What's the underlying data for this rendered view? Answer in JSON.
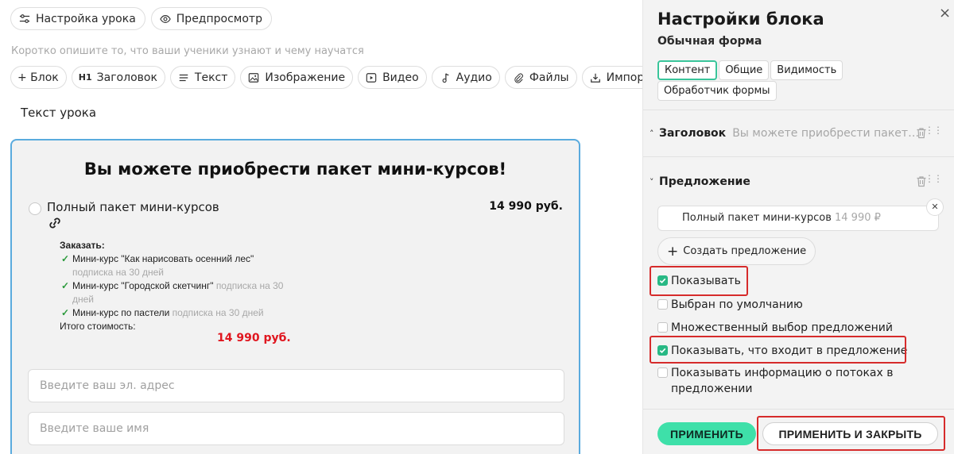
{
  "editor": {
    "lesson_settings_label": "Настройка урока",
    "preview_label": "Предпросмотр",
    "description_placeholder": "Коротко опишите то, что ваши ученики узнают и чему научатся",
    "toolbar": {
      "block": "+ Блок",
      "heading_tag": "H1",
      "heading": "Заголовок",
      "text": "Текст",
      "image": "Изображение",
      "video": "Видео",
      "audio": "Аудио",
      "files": "Файлы",
      "import": "Импорт"
    },
    "lesson_text_label": "Текст урока",
    "form": {
      "title": "Вы можете приобрести пакет мини-курсов!",
      "offer_name": "Полный пакет мини-курсов",
      "offer_price": "14 990 руб.",
      "order_label": "Заказать:",
      "items": [
        {
          "name": "Мини-курс \"Как нарисовать осенний лес\"",
          "sub": "подписка на 30 дней"
        },
        {
          "name": "Мини-курс \"Городской скетчинг\"",
          "sub": "подписка на 30 дней"
        },
        {
          "name": "Мини-курс по пастели",
          "sub": "подписка на 30 дней"
        }
      ],
      "total_label": "Итого стоимость:",
      "total_price": "14 990 руб.",
      "email_placeholder": "Введите ваш эл. адрес",
      "name_placeholder": "Введите ваше имя"
    }
  },
  "panel": {
    "title": "Настройки блока",
    "close": "×",
    "subtitle": "Обычная форма",
    "tabs": [
      "Контент",
      "Общие",
      "Видимость",
      "Обработчик формы"
    ],
    "active_tab": "Контент",
    "heading_section": {
      "label": "Заголовок",
      "value": "Вы можете приобрести пакет мини-курсов!"
    },
    "offer_section": {
      "label": "Предложение"
    },
    "offer_chip": {
      "name": "Полный пакет мини-курсов",
      "price": "14 990 ₽"
    },
    "create_offer": "Создать предложение",
    "checkboxes": [
      {
        "label": "Показывать",
        "checked": true
      },
      {
        "label": "Выбран по умолчанию",
        "checked": false
      },
      {
        "label": "Множественный выбор предложений",
        "checked": false
      },
      {
        "label": "Показывать, что входит в предложение",
        "checked": true
      },
      {
        "label": "Показывать информацию о потоках в предложении",
        "checked": false
      }
    ],
    "apply": "ПРИМЕНИТЬ",
    "apply_close": "ПРИМЕНИТЬ И ЗАКРЫТЬ",
    "colors": {
      "accent": "#3ee0a9",
      "check": "#28b884",
      "highlight": "#d62b2b",
      "price_red": "#e0161f",
      "selection": "#5aabde"
    }
  }
}
